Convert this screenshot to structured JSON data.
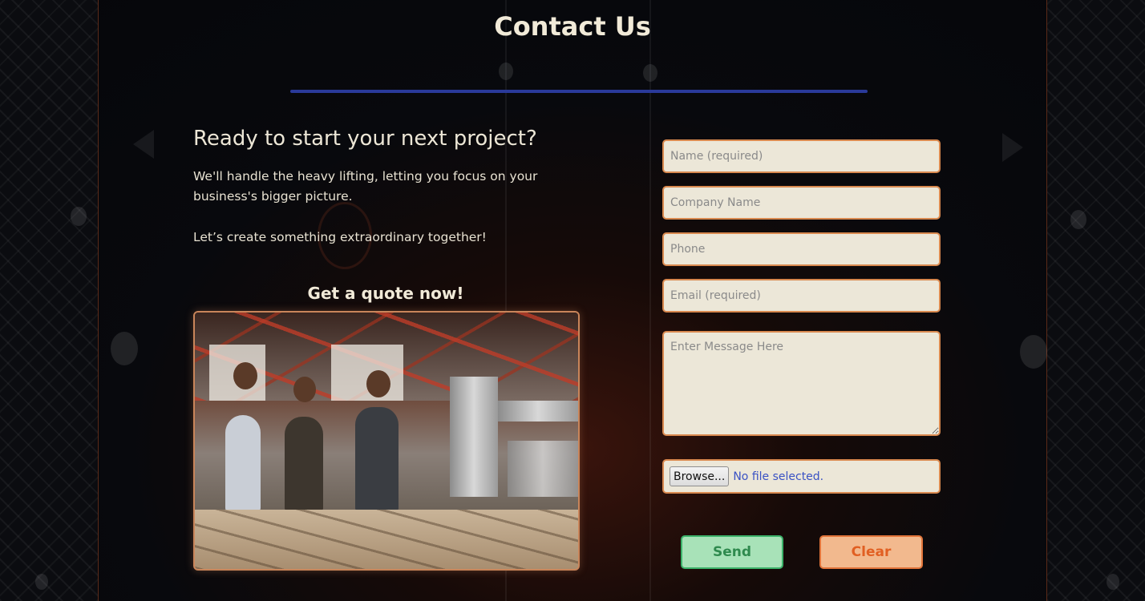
{
  "page": {
    "title": "Contact Us",
    "headline": "Ready to start your next project?",
    "lede": "We'll handle the heavy lifting, letting you focus on your business's bigger picture.",
    "lede_2": "Let’s create something extraordinary together!",
    "quote_heading": "Get a quote now!"
  },
  "form": {
    "name_placeholder": "Name (required)",
    "company_placeholder": "Company Name",
    "phone_placeholder": "Phone",
    "email_placeholder": "Email (required)",
    "message_placeholder": "Enter Message Here",
    "browse_label": "Browse...",
    "file_status": "No file selected.",
    "send_label": "Send",
    "clear_label": "Clear"
  },
  "colors": {
    "accent_rule": "#2a3a9a",
    "field_border": "#d9894f",
    "field_bg": "#ece7d8",
    "send_green": "#3cb36a",
    "clear_orange": "#e2743a"
  },
  "icons": [
    "workshop-photo"
  ]
}
